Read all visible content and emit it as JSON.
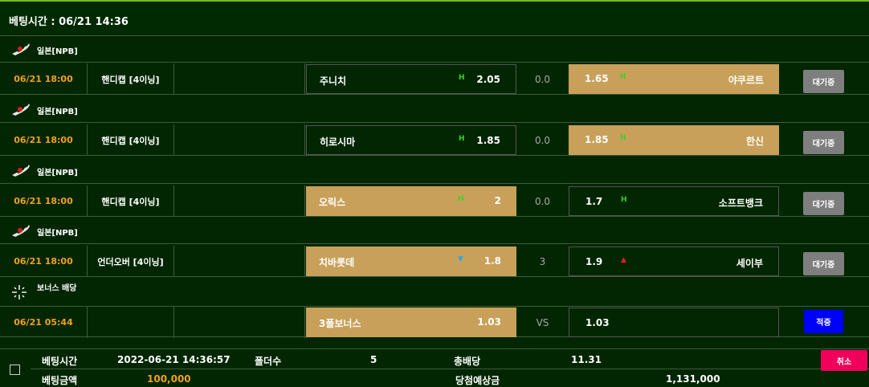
{
  "header": {
    "title": "베팅시간 : 06/21 14:36"
  },
  "blocks": [
    {
      "league": "일본[NPB]",
      "time": "06/21 18:00",
      "market": "핸디캡 [4이닝]",
      "home": {
        "name": "주니치",
        "indicator": "H",
        "odds": "2.05",
        "selected": false
      },
      "mid": "0.0",
      "away": {
        "name": "야쿠르트",
        "indicator": "H",
        "odds": "1.65",
        "selected": true
      },
      "status": "대기중"
    },
    {
      "league": "일본[NPB]",
      "time": "06/21 18:00",
      "market": "핸디캡 [4이닝]",
      "home": {
        "name": "히로시마",
        "indicator": "H",
        "odds": "1.85",
        "selected": false
      },
      "mid": "0.0",
      "away": {
        "name": "한신",
        "indicator": "H",
        "odds": "1.85",
        "selected": true
      },
      "status": "대기중"
    },
    {
      "league": "일본[NPB]",
      "time": "06/21 18:00",
      "market": "핸디캡 [4이닝]",
      "home": {
        "name": "오릭스",
        "indicator": "H",
        "odds": "2",
        "selected": true
      },
      "mid": "0.0",
      "away": {
        "name": "소프트뱅크",
        "indicator": "H",
        "odds": "1.7",
        "selected": false
      },
      "status": "대기중"
    },
    {
      "league": "일본[NPB]",
      "time": "06/21 18:00",
      "market": "언더오버 [4이닝]",
      "home": {
        "name": "치바롯데",
        "indicator": "▼",
        "odds": "1.8",
        "selected": true
      },
      "mid": "3",
      "away": {
        "name": "세이부",
        "indicator": "▲",
        "odds": "1.9",
        "selected": false
      },
      "status": "대기중"
    }
  ],
  "bonus": {
    "label": "보너스 배당",
    "time": "06/21 05:44",
    "home": {
      "name": "3폴보너스",
      "odds": "1.03"
    },
    "mid": "VS",
    "away": {
      "odds": "1.03"
    },
    "status": "적중"
  },
  "summary": {
    "bet_time_label": "베팅시간",
    "bet_time": "2022-06-21 14:36:57",
    "folders_label": "폴더수",
    "folders": "5",
    "total_odds_label": "총배당",
    "total_odds": "11.31",
    "amount_label": "베팅금액",
    "amount": "100,000",
    "expected_label": "당첨예상금",
    "expected": "1,131,000",
    "cancel_label": "취소"
  },
  "colors": {
    "accent_green": "#6bbf1f",
    "time_orange": "#f0a01e",
    "selected_gold": "#c8a05a",
    "cancel_pink": "#f0005a",
    "hit_blue": "#0000ff"
  },
  "icons": {
    "league": "japan-flag-icon",
    "bonus": "sparkle-icon"
  }
}
